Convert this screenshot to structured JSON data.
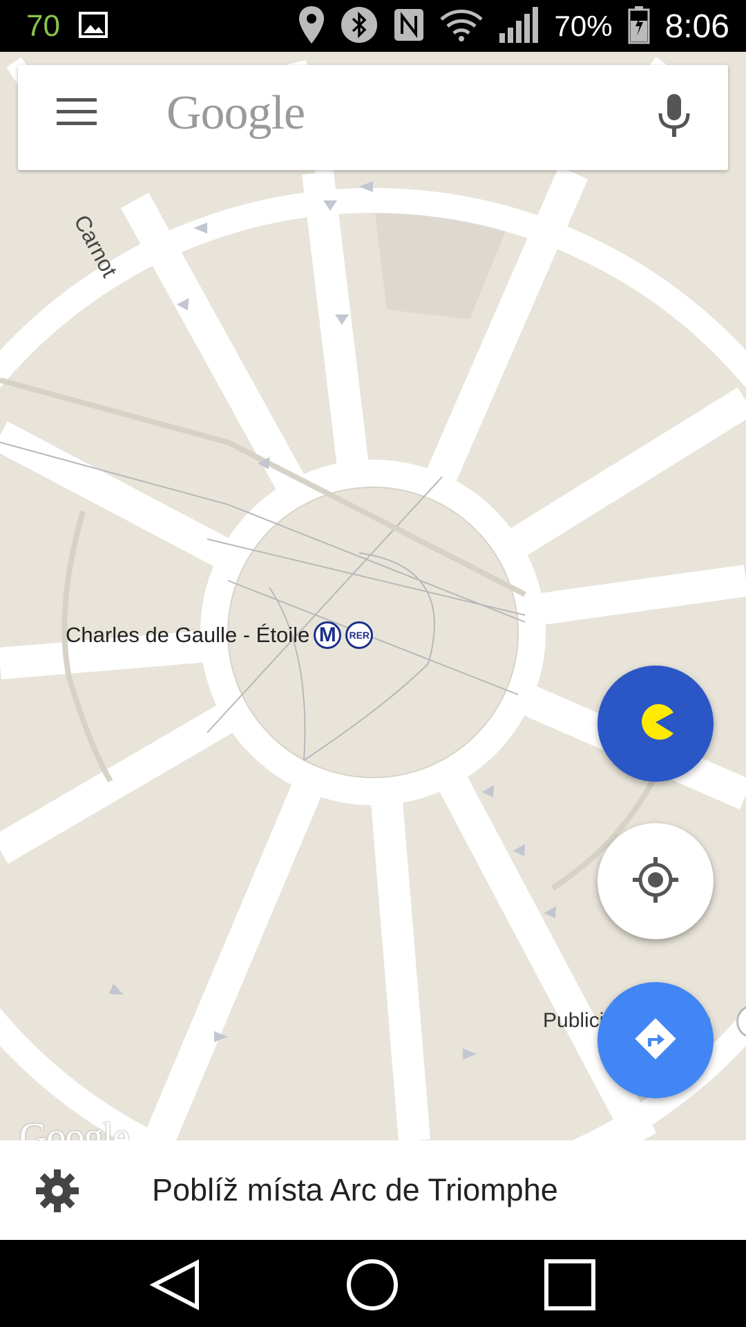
{
  "status_bar": {
    "notification_count": "70",
    "battery_percent": "70%",
    "time": "8:06",
    "icons": [
      "picture-icon",
      "location-pin-icon",
      "bluetooth-icon",
      "nfc-icon",
      "wifi-icon",
      "signal-icon",
      "battery-charging-icon"
    ]
  },
  "search": {
    "logo_text": "Google",
    "menu_icon": "hamburger-menu-icon",
    "voice_icon": "microphone-icon"
  },
  "map": {
    "street_label": "Carnot",
    "station_label": "Charles de Gaulle - Étoile",
    "metro_badge": "M",
    "rer_badge": "RER",
    "poi_label": "Publicis Drugstore",
    "watermark": "Google"
  },
  "buttons": {
    "pacman_icon": "pacman-icon",
    "my_location_icon": "my-location-icon",
    "directions_icon": "directions-icon"
  },
  "bottom_panel": {
    "icon": "gear-icon",
    "nearby_text": "Poblíž místa Arc de Triomphe"
  },
  "nav": {
    "back": "back-triangle-icon",
    "home": "home-circle-icon",
    "recents": "recents-square-icon"
  },
  "colors": {
    "map_bg": "#e8e4da",
    "road": "#ffffff",
    "pacman_fab": "#2a56c6",
    "pacman": "#ffeb00",
    "directions_fab": "#4285f4",
    "metro_badge": "#1b2f8a"
  }
}
